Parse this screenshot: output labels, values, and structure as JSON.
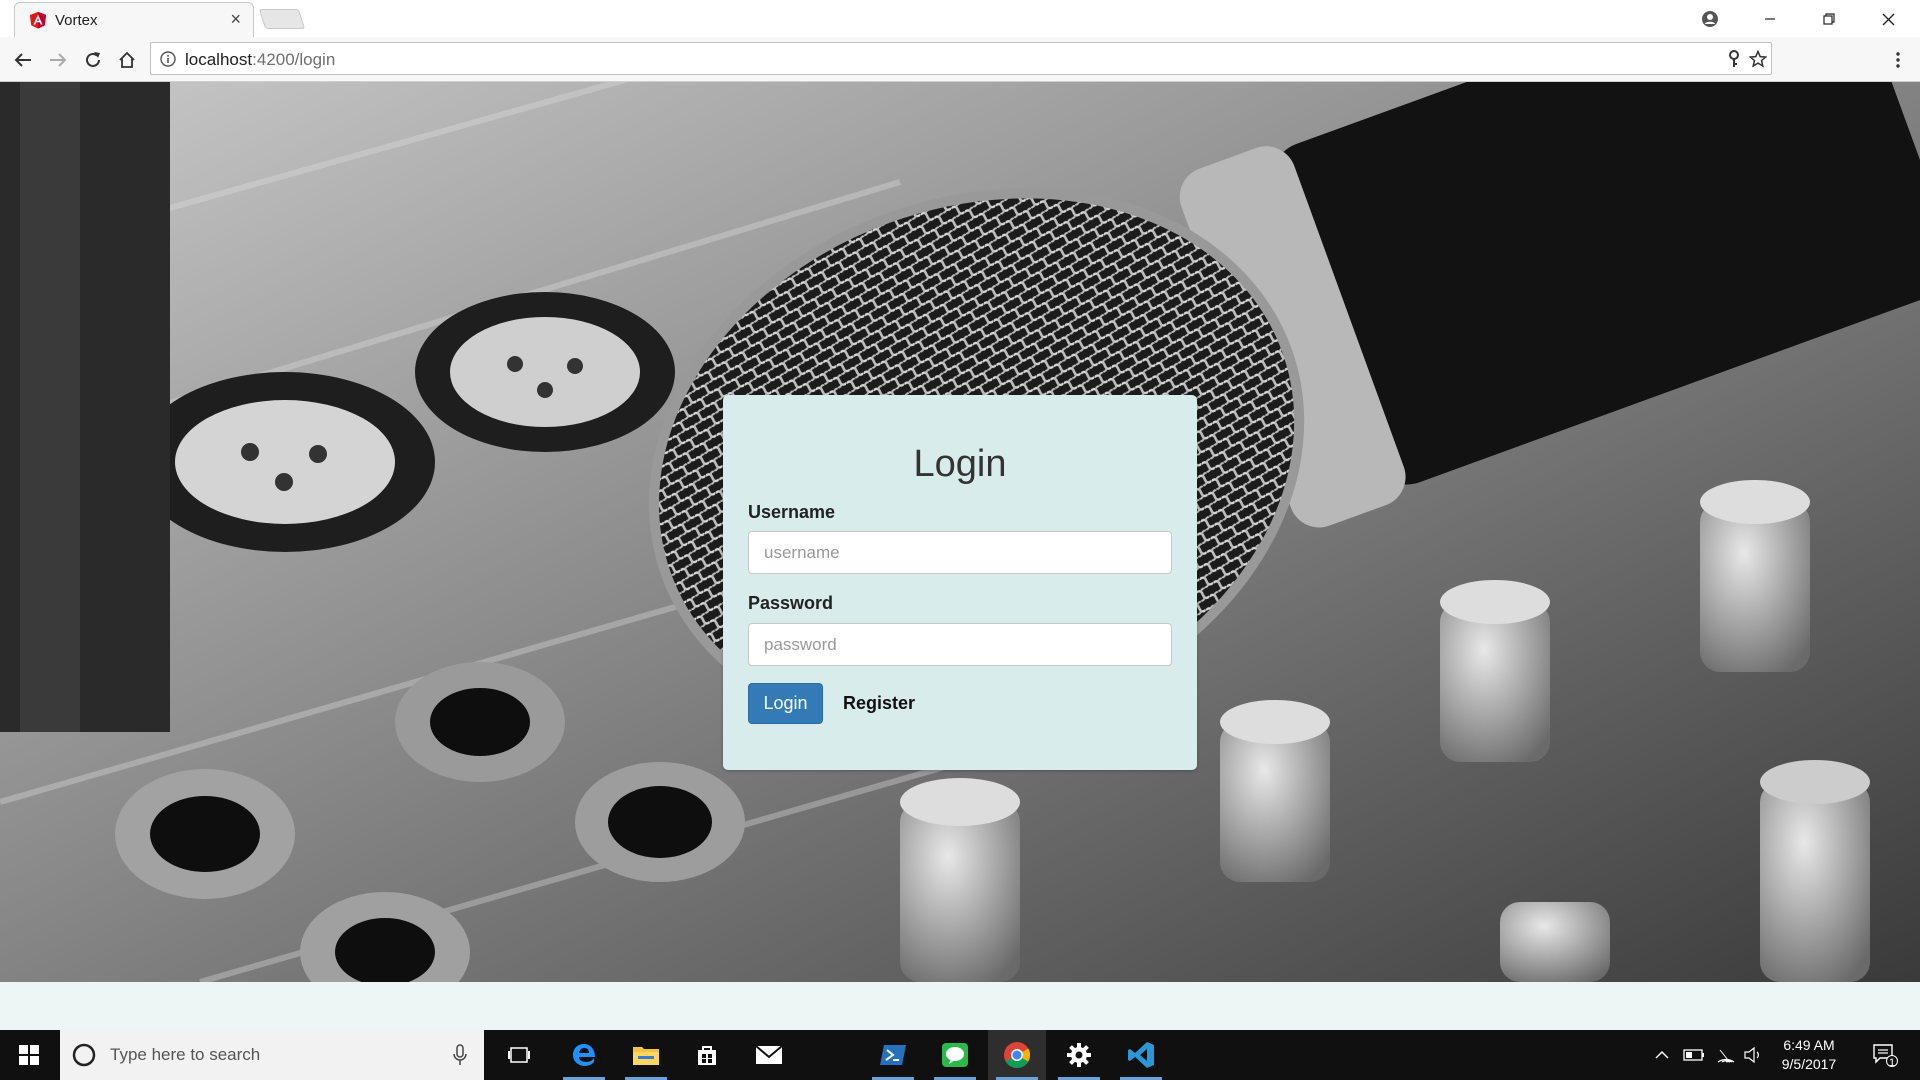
{
  "browser": {
    "tab_title": "Vortex",
    "tab_close": "×",
    "url_host": "localhost",
    "url_path": ":4200/login"
  },
  "login": {
    "title": "Login",
    "username_label": "Username",
    "username_placeholder": "username",
    "username_value": "",
    "password_label": "Password",
    "password_placeholder": "password",
    "password_value": "",
    "login_button": "Login",
    "register_link": "Register"
  },
  "taskbar": {
    "search_placeholder": "Type here to search",
    "time": "6:49 AM",
    "date": "9/5/2017",
    "notification_count": "1",
    "apps": [
      "task-view",
      "edge",
      "file-explorer",
      "store",
      "mail",
      "powershell",
      "chat",
      "chrome",
      "settings",
      "vscode"
    ]
  },
  "colors": {
    "card_bg": "#d9ecec",
    "login_button": "#337ab7",
    "angular_red": "#dd1b16",
    "taskbar_bg": "#101010"
  }
}
